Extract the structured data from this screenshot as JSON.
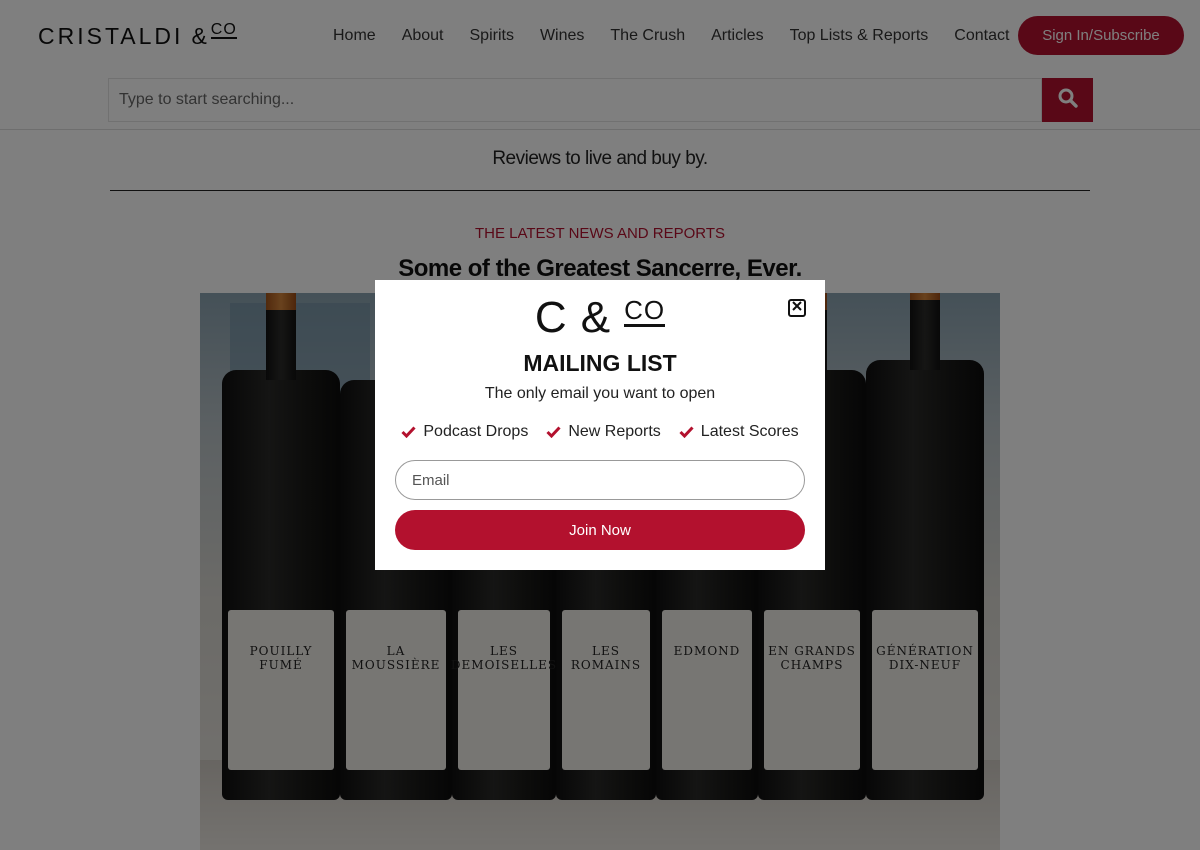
{
  "header": {
    "logo_text": "CRISTALDI",
    "logo_amp": "&",
    "logo_co": "CO",
    "nav": [
      "Home",
      "About",
      "Spirits",
      "Wines",
      "The Crush",
      "Articles",
      "Top Lists & Reports",
      "Contact"
    ],
    "signin_label": "Sign In/Subscribe"
  },
  "search": {
    "placeholder": "Type to start searching..."
  },
  "tagline": "Reviews to live and buy by.",
  "feature": {
    "eyebrow": "THE LATEST NEWS AND REPORTS",
    "headline": "Some of the Greatest Sancerre, Ever.",
    "bottle_labels": [
      "POUILLY FUMÉ",
      "LA MOUSSIÈRE",
      "LES DEMOISELLES",
      "LES ROMAINS",
      "EDMOND",
      "EN GRANDS CHAMPS",
      "GÉNÉRATION DIX-NEUF"
    ]
  },
  "modal": {
    "logo_c": "C",
    "logo_amp": "&",
    "logo_co": "CO",
    "title": "MAILING LIST",
    "subtitle": "The only email you want to open",
    "benefits": [
      "Podcast Drops",
      "New Reports",
      "Latest Scores"
    ],
    "email_placeholder": "Email",
    "join_label": "Join Now"
  },
  "colors": {
    "accent": "#b3112e",
    "overlay": "rgba(0,0,0,0.5)"
  },
  "icons": {
    "search": "search-icon",
    "close": "close-icon",
    "check": "check-icon"
  }
}
